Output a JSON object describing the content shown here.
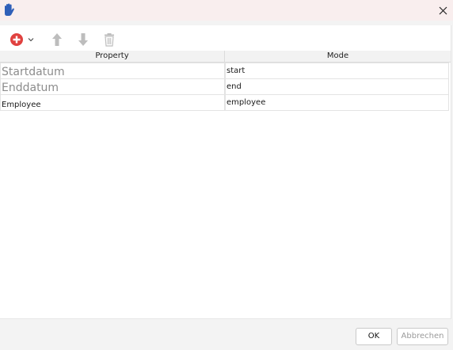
{
  "window": {
    "app_icon": "hand-icon",
    "close_icon": "close-icon"
  },
  "toolbar": {
    "add_icon": "add-circle-icon",
    "dropdown_icon": "chevron-down-icon",
    "move_up_icon": "arrow-up-icon",
    "move_down_icon": "arrow-down-icon",
    "delete_icon": "trash-icon",
    "colors": {
      "add": "#e0413f",
      "disabled": "#bdbdbd"
    }
  },
  "table": {
    "columns": [
      "Property",
      "Mode"
    ],
    "rows": [
      {
        "property": "Startdatum",
        "property_is_placeholder": true,
        "mode": "start"
      },
      {
        "property": "Enddatum",
        "property_is_placeholder": true,
        "mode": "end"
      },
      {
        "property": "Employee",
        "property_is_placeholder": false,
        "mode": "employee"
      }
    ]
  },
  "footer": {
    "ok_label": "OK",
    "cancel_label": "Abbrechen"
  }
}
